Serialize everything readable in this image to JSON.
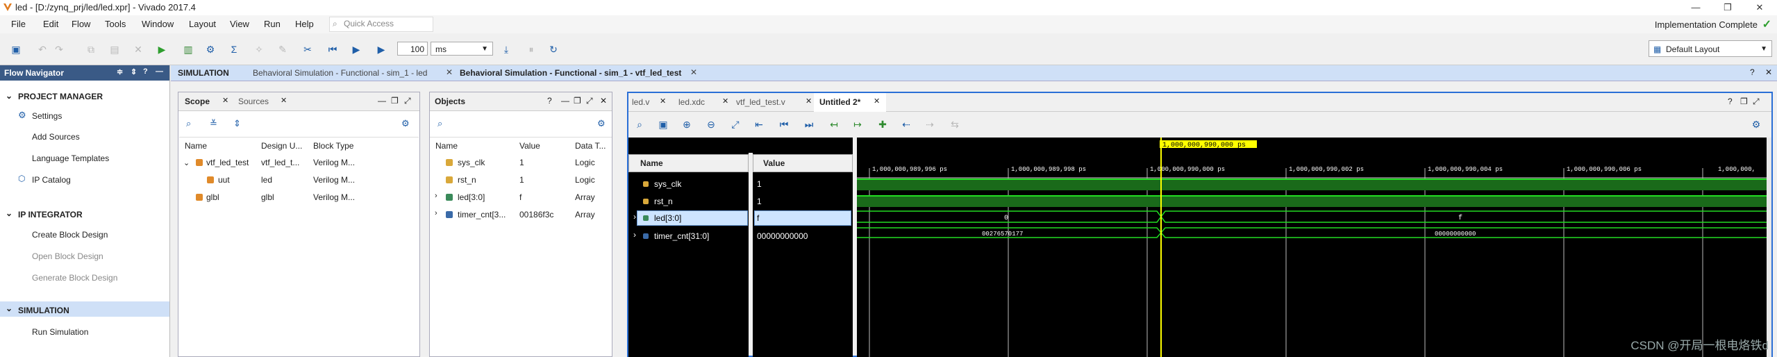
{
  "window": {
    "title": "led - [D:/zynq_prj/led/led.xpr] - Vivado 2017.4"
  },
  "menu": [
    "File",
    "Edit",
    "Flow",
    "Tools",
    "Window",
    "Layout",
    "View",
    "Run",
    "Help"
  ],
  "quick_access": {
    "placeholder": "Quick Access"
  },
  "status": {
    "implementation": "Implementation Complete"
  },
  "toolbar": {
    "run_time_value": "100",
    "run_time_unit": "ms",
    "layout": "Default Layout"
  },
  "flow_navigator": {
    "title": "Flow Navigator",
    "project_manager": {
      "label": "PROJECT MANAGER",
      "items": [
        "Settings",
        "Add Sources",
        "Language Templates",
        "IP Catalog"
      ]
    },
    "ip_integrator": {
      "label": "IP INTEGRATOR",
      "items": [
        "Create Block Design",
        "Open Block Design",
        "Generate Block Design"
      ]
    },
    "simulation": {
      "label": "SIMULATION",
      "items": [
        "Run Simulation"
      ]
    }
  },
  "sim_header": {
    "label": "SIMULATION",
    "tabs": [
      "Behavioral Simulation - Functional - sim_1 - led",
      "Behavioral Simulation - Functional - sim_1 - vtf_led_test"
    ]
  },
  "scope_panel": {
    "tabs": [
      "Scope",
      "Sources"
    ],
    "columns": [
      "Name",
      "Design U...",
      "Block Type"
    ],
    "rows": [
      {
        "name": "vtf_led_test",
        "design": "vtf_led_t...",
        "type": "Verilog M..."
      },
      {
        "name": "uut",
        "design": "led",
        "type": "Verilog M..."
      },
      {
        "name": "glbl",
        "design": "glbl",
        "type": "Verilog M..."
      }
    ]
  },
  "objects_panel": {
    "title": "Objects",
    "columns": [
      "Name",
      "Value",
      "Data T..."
    ],
    "rows": [
      {
        "name": "sys_clk",
        "value": "1",
        "type": "Logic"
      },
      {
        "name": "rst_n",
        "value": "1",
        "type": "Logic"
      },
      {
        "name": "led[3:0]",
        "value": "f",
        "type": "Array"
      },
      {
        "name": "timer_cnt[3...",
        "value": "00186f3c",
        "type": "Array"
      }
    ]
  },
  "wave_tabs": [
    "led.v",
    "led.xdc",
    "vtf_led_test.v",
    "Untitled 2*"
  ],
  "wave": {
    "cursor_label": "1,000,000,990,000 ps",
    "name_header": "Name",
    "value_header": "Value",
    "signals": [
      {
        "name": "sys_clk",
        "value": "1"
      },
      {
        "name": "rst_n",
        "value": "1"
      },
      {
        "name": "led[3:0]",
        "value": "f"
      },
      {
        "name": "timer_cnt[31:0]",
        "value": "00000000000"
      }
    ],
    "time_ticks": [
      "1,000,000,989,996 ps",
      "1,000,000,989,998 ps",
      "1,000,000,990,000 ps",
      "1,000,000,990,002 ps",
      "1,000,000,990,004 ps",
      "1,000,000,990,006 ps",
      "1,000,000,"
    ],
    "led_values": [
      "0",
      "f"
    ],
    "timer_values": [
      "00276570177",
      "00000000000"
    ]
  },
  "watermark": "CSDN @开局一根电烙铁d"
}
